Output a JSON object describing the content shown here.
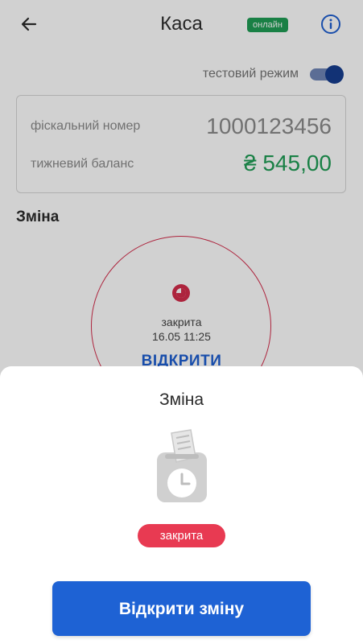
{
  "header": {
    "title": "Каса",
    "online_badge": "онлайн"
  },
  "test_mode": {
    "label": "тестовий режим",
    "enabled": true
  },
  "card": {
    "fiscal_label": "фіскальний номер",
    "fiscal_value": "1000123456",
    "balance_label": "тижневий баланс",
    "balance_value": "₴ 545,00"
  },
  "shift": {
    "section_title": "Зміна",
    "status": "закрита",
    "time": "16.05 11:25",
    "open_label": "ВІДКРИТИ"
  },
  "sheet": {
    "title": "Зміна",
    "status_badge": "закрита",
    "open_button": "Відкрити зміну"
  },
  "colors": {
    "accent_blue": "#1e62d4",
    "online_green": "#1f9d55",
    "closed_red": "#e83a52"
  },
  "icons": {
    "back": "arrow-left-icon",
    "info": "info-circle-icon",
    "shift_status": "clock-pie-icon",
    "sheet_illustration": "receipt-clock-icon"
  }
}
